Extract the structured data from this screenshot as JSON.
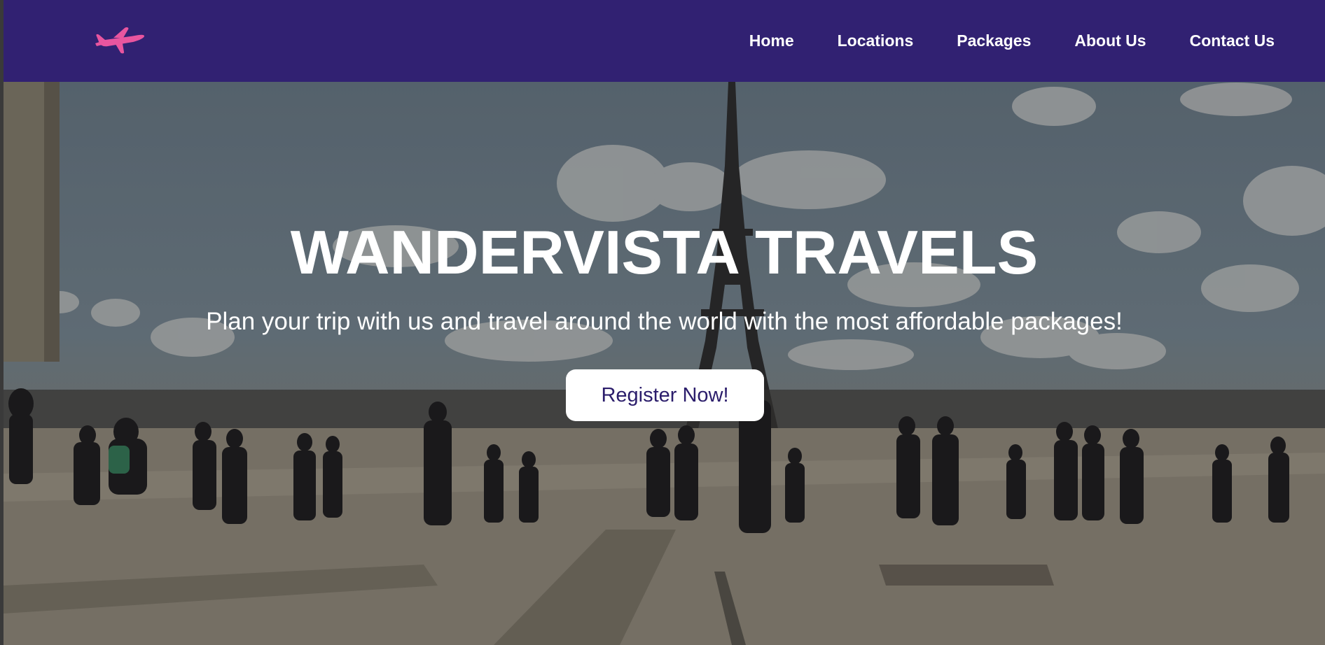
{
  "nav": {
    "logo_icon": "airplane-icon",
    "items": [
      {
        "label": "Home"
      },
      {
        "label": "Locations"
      },
      {
        "label": "Packages"
      },
      {
        "label": "About Us"
      },
      {
        "label": "Contact Us"
      }
    ]
  },
  "hero": {
    "background": "Eiffel Tower plaza with crowd of walking people under cloudy sky",
    "title": "WANDERVISTA TRAVELS",
    "subtitle": "Plan your trip with us and travel around the world with the most affordable packages!",
    "cta_label": "Register Now!"
  },
  "colors": {
    "navbar": "#312172",
    "logo": "#e8559f",
    "cta_text": "#2b1d6b"
  }
}
